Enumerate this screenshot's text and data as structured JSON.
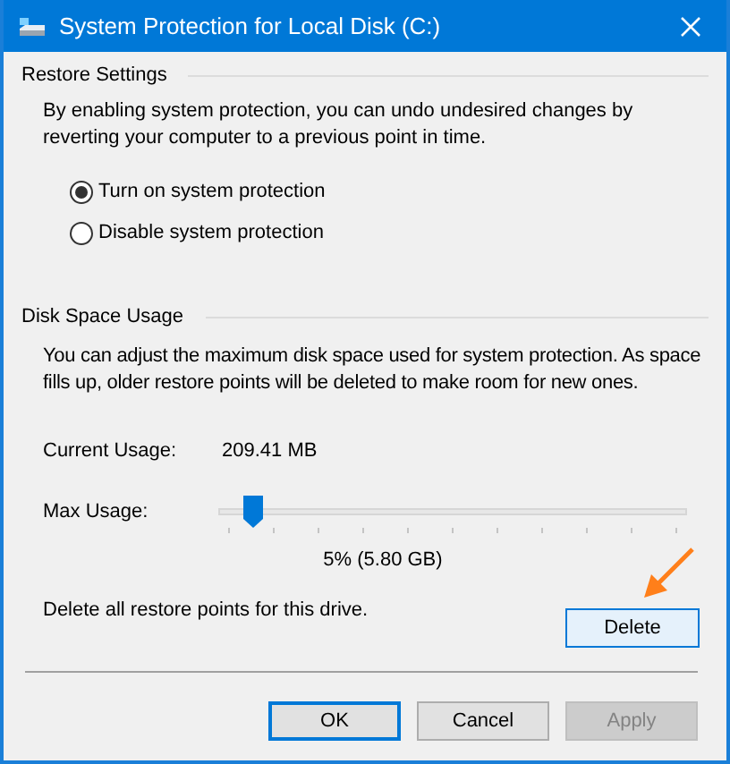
{
  "window": {
    "title": "System Protection for Local Disk (C:)"
  },
  "restore_settings": {
    "heading": "Restore Settings",
    "description": "By enabling system protection, you can undo undesired changes by reverting your computer to a previous point in time.",
    "options": [
      {
        "label": "Turn on system protection",
        "selected": true
      },
      {
        "label": "Disable system protection",
        "selected": false
      }
    ]
  },
  "disk_space_usage": {
    "heading": "Disk Space Usage",
    "description": "You can adjust the maximum disk space used for system protection. As space fills up, older restore points will be deleted to make room for new ones.",
    "current_usage": {
      "label": "Current Usage:",
      "value": "209.41 MB"
    },
    "max_usage": {
      "label": "Max Usage:",
      "level": 0.05,
      "reading": "5% (5.80 GB)"
    },
    "delete": {
      "text": "Delete all restore points for this drive.",
      "button": "Delete",
      "hovered": true
    }
  },
  "buttons": [
    {
      "label": "OK",
      "default": true,
      "disabled": false
    },
    {
      "label": "Cancel",
      "default": false,
      "disabled": false
    },
    {
      "label": "Apply",
      "default": false,
      "disabled": true
    }
  ]
}
